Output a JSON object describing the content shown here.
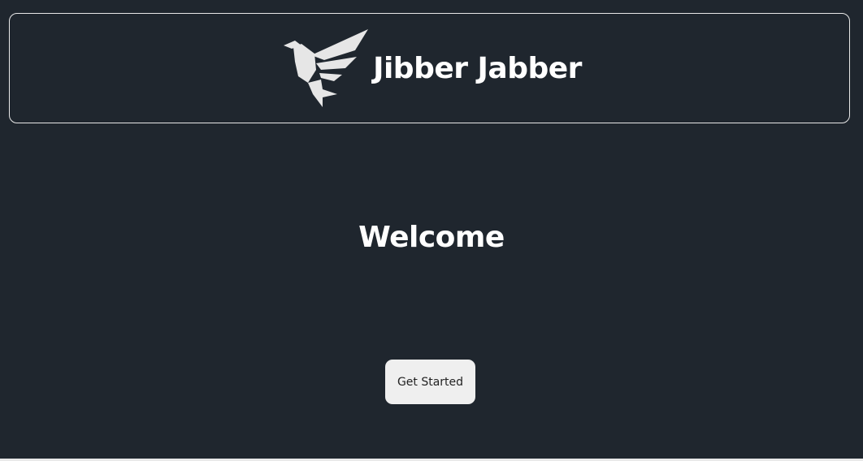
{
  "header": {
    "logo_icon": "bird-logo-icon",
    "title": "Jibber Jabber"
  },
  "main": {
    "heading": "Welcome",
    "cta_label": "Get Started"
  },
  "colors": {
    "background": "#1f262e",
    "header_border": "#e8e8e8",
    "text": "#ffffff",
    "button_bg": "#efefef",
    "button_text": "#222222"
  }
}
